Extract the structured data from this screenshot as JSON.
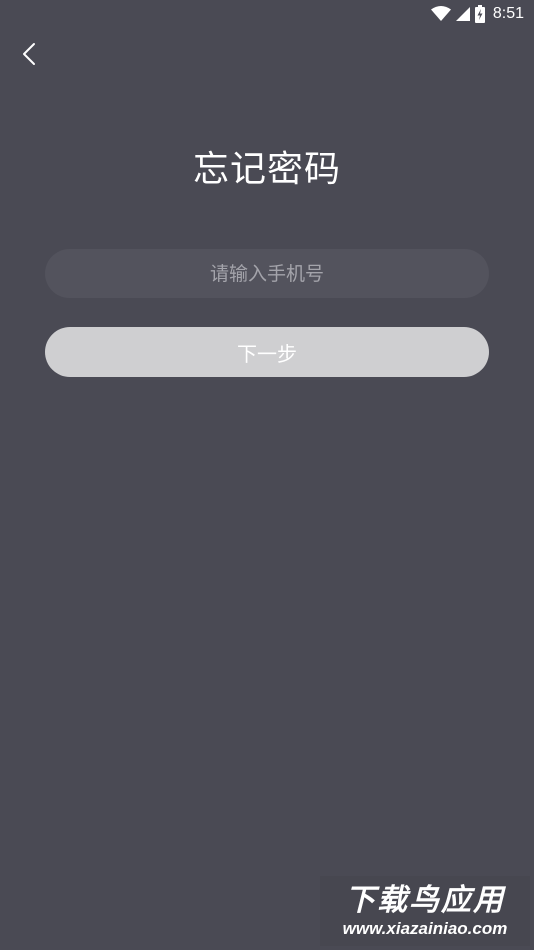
{
  "status_bar": {
    "time": "8:51",
    "icons": [
      "wifi-icon",
      "signal-icon",
      "battery-charging-icon"
    ]
  },
  "header": {
    "back_icon": "chevron-left-icon",
    "title": "忘记密码"
  },
  "form": {
    "phone_input": {
      "value": "",
      "placeholder": "请输入手机号"
    },
    "next_label": "下一步"
  },
  "watermark": {
    "title": "下载鸟应用",
    "url": "www.xiazainiao.com"
  },
  "colors": {
    "background": "#4a4a54",
    "input_background": "#53535d",
    "placeholder": "#a4a4ab",
    "button_disabled": "#cfcfd1",
    "text": "#ffffff"
  }
}
